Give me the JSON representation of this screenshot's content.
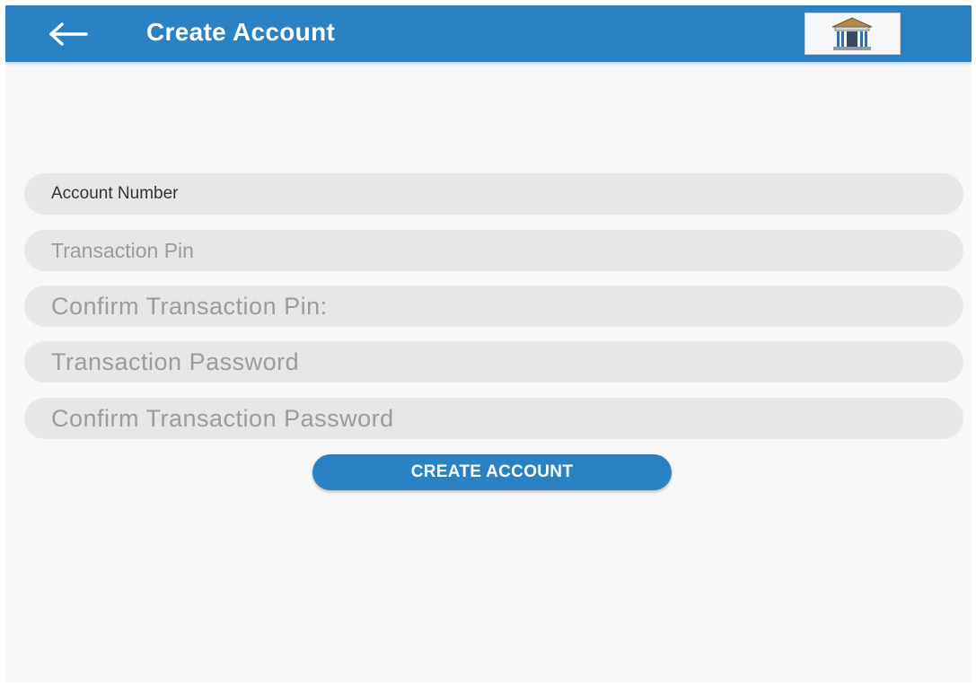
{
  "colors": {
    "app_bar": "#2a82c4",
    "background": "#f7f7f7",
    "field_bg": "#e7e7e7",
    "button": "#2a82c4",
    "button_text": "#ffffff",
    "placeholder": "#9c9c9c"
  },
  "app_bar": {
    "title": "Create Account",
    "back_icon": "arrow-left-icon",
    "logo_icon": "bank-building-icon"
  },
  "form": {
    "account_number": {
      "value": "",
      "placeholder": "Account Number"
    },
    "transaction_pin": {
      "value": "",
      "placeholder": "Transaction Pin"
    },
    "confirm_transaction_pin": {
      "value": "",
      "placeholder": "Confirm Transaction Pin:"
    },
    "transaction_password": {
      "value": "",
      "placeholder": "Transaction Password"
    },
    "confirm_transaction_password": {
      "value": "",
      "placeholder": "Confirm Transaction Password"
    },
    "submit_label": "CREATE ACCOUNT"
  }
}
